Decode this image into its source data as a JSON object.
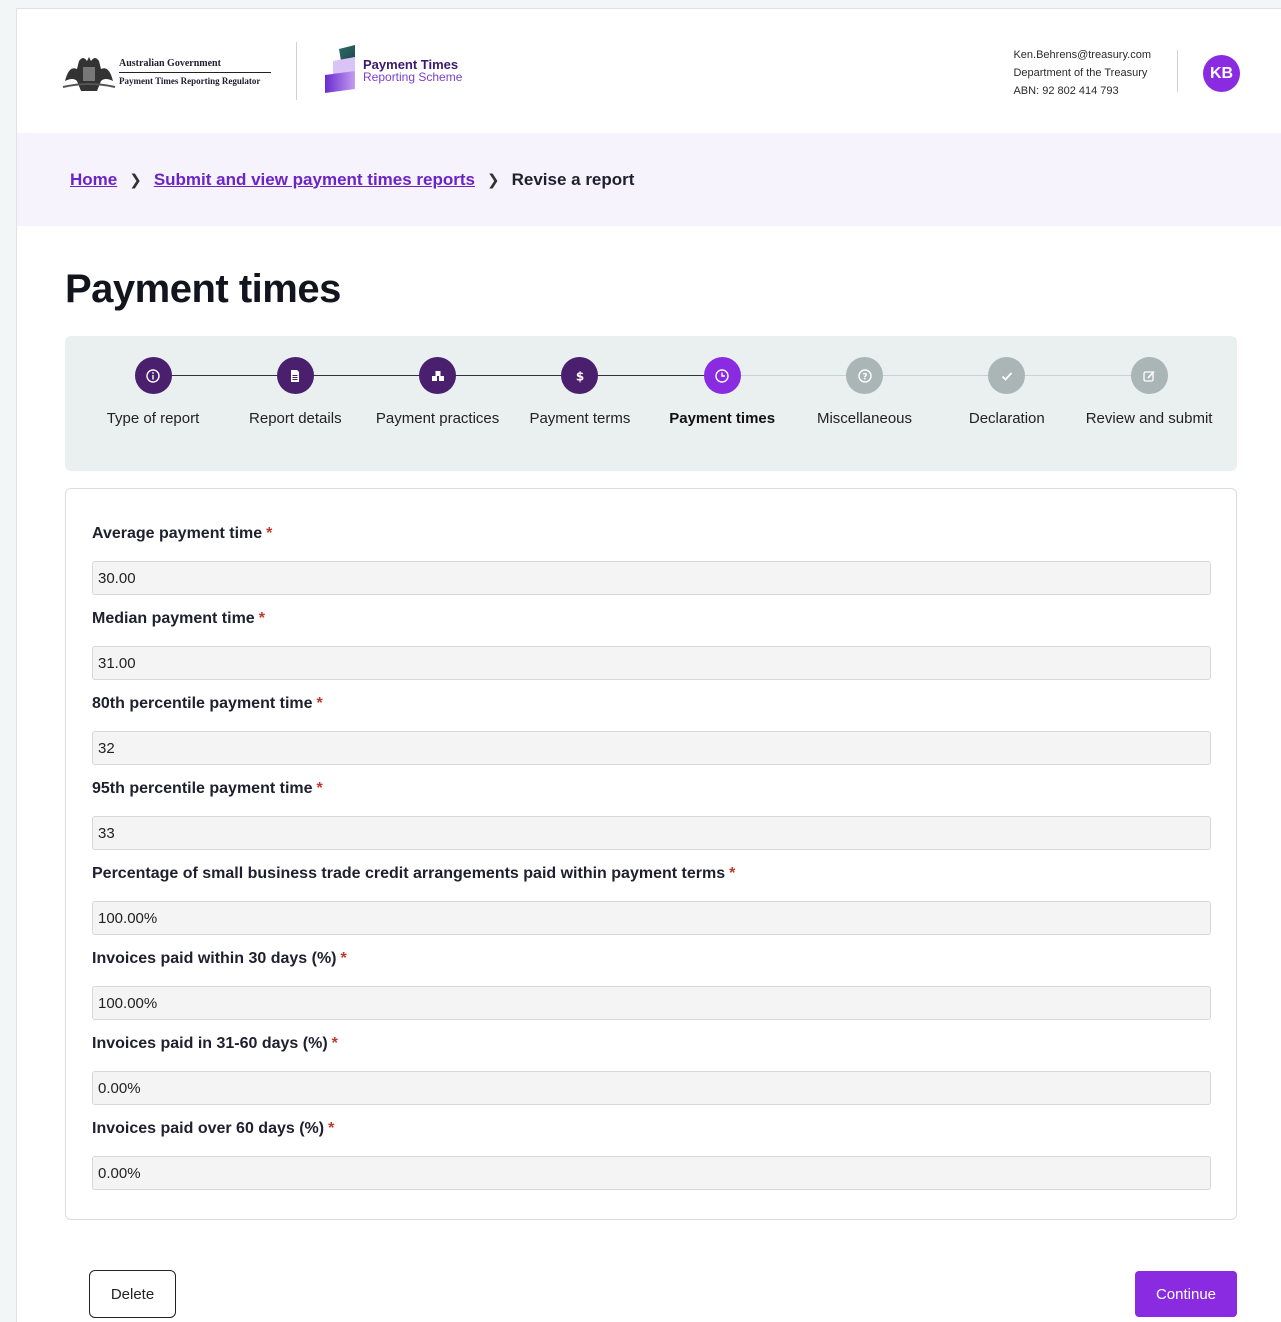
{
  "header": {
    "gov_line1": "Australian Government",
    "gov_line2": "Payment Times Reporting Regulator",
    "brand_line1": "Payment Times",
    "brand_line2": "Reporting Scheme",
    "user_email": "Ken.Behrens@treasury.com",
    "user_org": "Department of the Treasury",
    "user_abn": "ABN: 92 802 414 793",
    "avatar_initials": "KB"
  },
  "breadcrumb": {
    "home": "Home",
    "submit": "Submit and view payment times reports",
    "current": "Revise a report"
  },
  "page_title": "Payment times",
  "steps": [
    {
      "label": "Type of report",
      "status": "done",
      "icon": "info-icon"
    },
    {
      "label": "Report details",
      "status": "done",
      "icon": "document-icon"
    },
    {
      "label": "Payment practices",
      "status": "done",
      "icon": "boxes-icon"
    },
    {
      "label": "Payment terms",
      "status": "done",
      "icon": "dollar-icon"
    },
    {
      "label": "Payment times",
      "status": "active",
      "icon": "clock-icon"
    },
    {
      "label": "Miscellaneous",
      "status": "pending",
      "icon": "question-icon"
    },
    {
      "label": "Declaration",
      "status": "pending",
      "icon": "check-icon"
    },
    {
      "label": "Review and submit",
      "status": "pending",
      "icon": "edit-icon"
    }
  ],
  "fields": [
    {
      "label": "Average payment time",
      "value": "30.00"
    },
    {
      "label": "Median payment time",
      "value": "31.00"
    },
    {
      "label": "80th percentile payment time",
      "value": "32"
    },
    {
      "label": "95th percentile payment time",
      "value": "33"
    },
    {
      "label": "Percentage of small business trade credit arrangements paid within payment terms",
      "value": "100.00%"
    },
    {
      "label": "Invoices paid within 30 days (%)",
      "value": "100.00%"
    },
    {
      "label": "Invoices paid in 31-60 days (%)",
      "value": "0.00%"
    },
    {
      "label": "Invoices paid over 60 days (%)",
      "value": "0.00%"
    }
  ],
  "required_marker": "*",
  "buttons": {
    "delete": "Delete",
    "continue": "Continue"
  },
  "colors": {
    "brand_purple": "#8a2be2",
    "step_done": "#4a1f6e",
    "step_pending": "#aab6b5"
  }
}
